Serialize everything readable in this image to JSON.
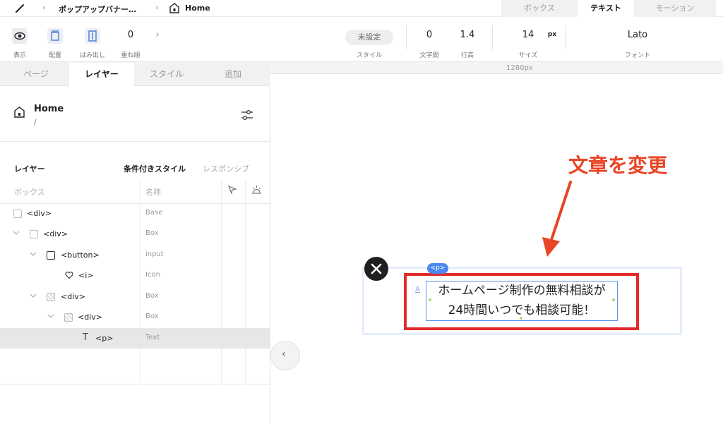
{
  "topbar": {
    "breadcrumb_project": "ポップアップバナー…",
    "breadcrumb_page": "Home",
    "tabs": [
      {
        "label": "ボックス",
        "active": false
      },
      {
        "label": "テキスト",
        "active": true
      },
      {
        "label": "モーション",
        "active": false
      }
    ]
  },
  "toolbar": {
    "show_label": "表示",
    "arrange_label": "配置",
    "overflow_label": "はみ出し",
    "order_value": "0",
    "order_label": "重ね順",
    "style_value": "未設定",
    "style_label": "スタイル",
    "letter_spacing_value": "0",
    "letter_spacing_label": "文字間",
    "line_height_value": "1.4",
    "line_height_label": "行高",
    "size_value": "14",
    "size_unit": "px",
    "size_label": "サイズ",
    "font_value": "Lato",
    "font_label": "フォント"
  },
  "panel": {
    "tabs": [
      {
        "label": "ページ",
        "active": false
      },
      {
        "label": "レイヤー",
        "active": true
      },
      {
        "label": "スタイル",
        "active": false
      },
      {
        "label": "追加",
        "active": false
      }
    ],
    "page_title": "Home",
    "page_path": "/",
    "layers_title": "レイヤー",
    "conditional_style": "条件付きスタイル",
    "responsive": "レスポンシブ",
    "col_box": "ボックス",
    "col_name": "名称",
    "rows": [
      {
        "tag": "<div>",
        "type": "Base"
      },
      {
        "tag": "<div>",
        "type": "Box"
      },
      {
        "tag": "<button>",
        "type": "input"
      },
      {
        "tag": "<i>",
        "type": "Icon"
      },
      {
        "tag": "<div>",
        "type": "Box"
      },
      {
        "tag": "<div>",
        "type": "Box"
      },
      {
        "tag": "<p>",
        "type": "Text",
        "selected": true
      }
    ]
  },
  "canvas": {
    "ruler_label": "1280px",
    "annotation": "文章を変更",
    "p_tag": "<p>",
    "text_line1": "ホームページ制作の無料相談が",
    "text_line2": "24時間いつでも相談可能！"
  },
  "colors": {
    "accent_red": "#e12a2a",
    "annotation_red": "#e94425",
    "selection_blue": "#4b87f0"
  }
}
